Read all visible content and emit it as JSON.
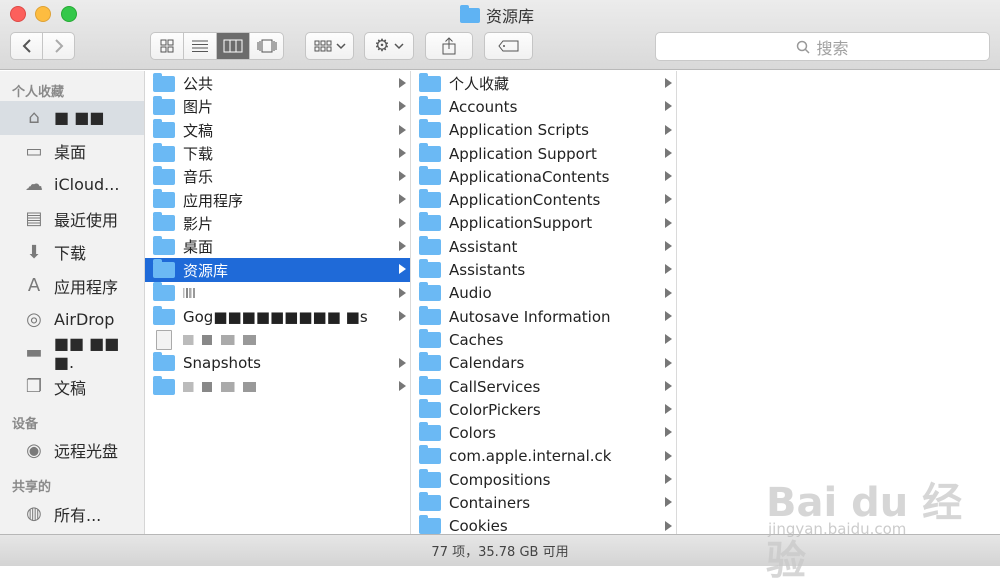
{
  "window": {
    "title": "资源库"
  },
  "toolbar": {
    "back_icon": "chevron-left-icon",
    "forward_icon": "chevron-right-icon",
    "view_modes": [
      "icon-view-icon",
      "list-view-icon",
      "column-view-icon",
      "cover-flow-icon"
    ],
    "active_view": 2,
    "search_placeholder": "搜索"
  },
  "sidebar": {
    "sections": [
      {
        "heading": "个人收藏",
        "items": [
          {
            "label": "■ ■■",
            "icon": "home-icon",
            "selected": true
          },
          {
            "label": "桌面",
            "icon": "desktop-icon"
          },
          {
            "label": "iCloud...",
            "icon": "cloud-icon"
          },
          {
            "label": "最近使用",
            "icon": "recents-icon"
          },
          {
            "label": "下载",
            "icon": "download-icon"
          },
          {
            "label": "应用程序",
            "icon": "applications-icon"
          },
          {
            "label": "AirDrop",
            "icon": "airdrop-icon"
          },
          {
            "label": "■■ ■■ ■.",
            "icon": "folder-icon"
          },
          {
            "label": "文稿",
            "icon": "documents-icon"
          }
        ]
      },
      {
        "heading": "设备",
        "items": [
          {
            "label": "远程光盘",
            "icon": "disc-icon"
          }
        ]
      },
      {
        "heading": "共享的",
        "items": [
          {
            "label": "所有...",
            "icon": "network-icon"
          }
        ]
      }
    ]
  },
  "column1": {
    "items": [
      {
        "label": "公共",
        "type": "folder"
      },
      {
        "label": "图片",
        "type": "folder"
      },
      {
        "label": "文稿",
        "type": "folder"
      },
      {
        "label": "下载",
        "type": "folder"
      },
      {
        "label": "音乐",
        "type": "folder"
      },
      {
        "label": "应用程序",
        "type": "folder"
      },
      {
        "label": "影片",
        "type": "folder"
      },
      {
        "label": "桌面",
        "type": "folder"
      },
      {
        "label": "资源库",
        "type": "folder",
        "selected": true
      },
      {
        "label": "",
        "type": "folder",
        "redacted": true
      },
      {
        "label": "Gog■■■■■■■■■ ■s",
        "type": "folder",
        "redacted": true
      },
      {
        "label": "",
        "type": "file",
        "redacted": true
      },
      {
        "label": "Snapshots",
        "type": "folder"
      },
      {
        "label": "",
        "type": "folder",
        "redacted": true
      }
    ]
  },
  "column2": {
    "items": [
      "个人收藏",
      "Accounts",
      "Application Scripts",
      "Application Support",
      "ApplicationaContents",
      "ApplicationContents",
      "ApplicationSupport",
      "Assistant",
      "Assistants",
      "Audio",
      "Autosave Information",
      "Caches",
      "Calendars",
      "CallServices",
      "ColorPickers",
      "Colors",
      "com.apple.internal.ck",
      "Compositions",
      "Containers",
      "Cookies"
    ]
  },
  "statusbar": {
    "text": "77 项，35.78 GB 可用"
  },
  "watermark": {
    "brand": "Bai du 经验",
    "url": "jingyan.baidu.com"
  }
}
